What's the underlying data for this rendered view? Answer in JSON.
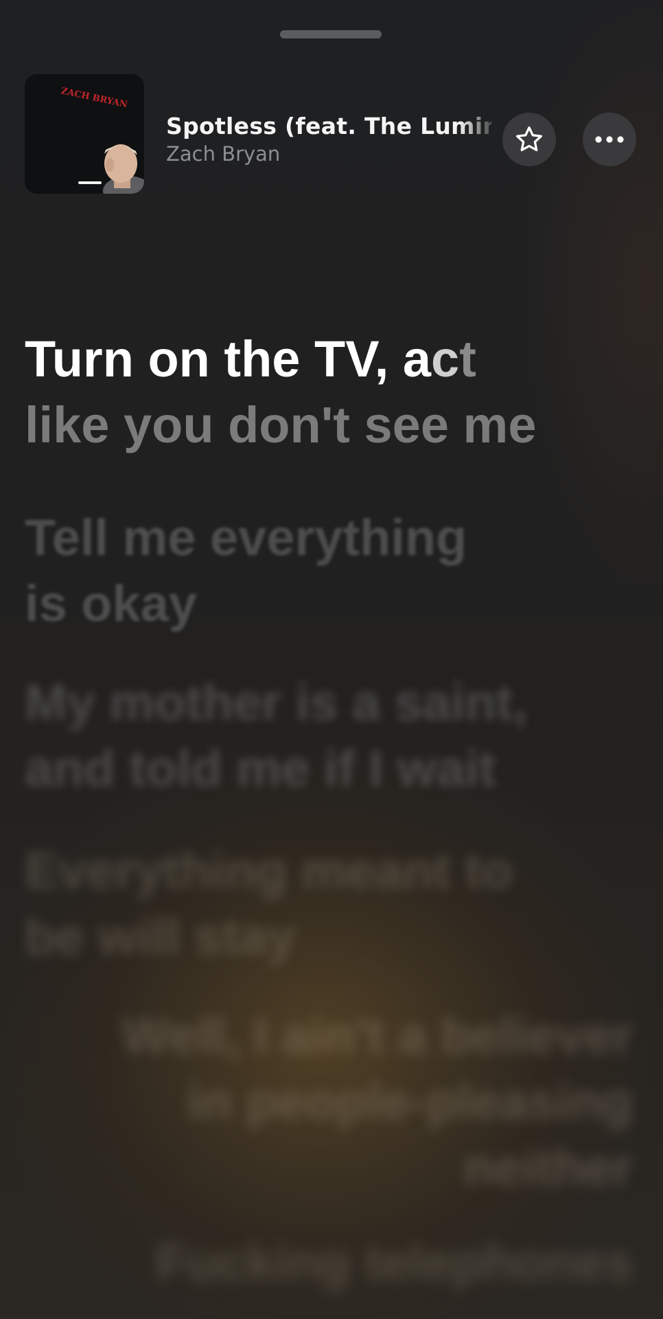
{
  "now_playing": {
    "title": "Spotless (feat. The Lumineers)",
    "artist": "Zach Bryan",
    "artwork_text": "ZACH BRYAN"
  },
  "actions": {
    "favorite_icon": "star-icon",
    "more_icon": "ellipsis-icon"
  },
  "lyrics": {
    "active": {
      "line1_words": [
        "Turn on the TV, ",
        "a",
        "c",
        "t"
      ],
      "line2": "like you don't see me"
    },
    "upcoming": [
      {
        "line1": "Tell me everything",
        "line2": "is okay"
      },
      {
        "line1": "My mother is a saint,",
        "line2": "and told me if I wait"
      },
      {
        "line1": "Everything meant to",
        "line2": "be will stay"
      },
      {
        "line1": "Well, I ain't a believer",
        "line2": "in people-pleasing",
        "line3": "neither"
      },
      {
        "line1": "Fucking telephones"
      }
    ]
  },
  "colors": {
    "background": "#1f2022",
    "button_bg": "#3a3a3c",
    "artist_text": "#8d8e90",
    "artwork_text": "#c0262b"
  }
}
